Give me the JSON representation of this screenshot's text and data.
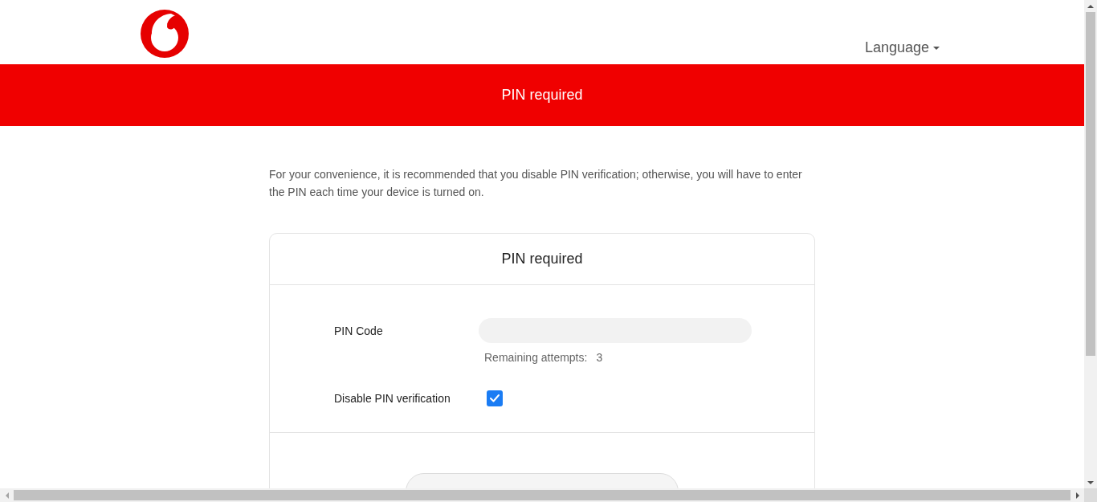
{
  "header": {
    "language_menu": {
      "label": "Language"
    }
  },
  "banner": {
    "title": "PIN required"
  },
  "intro": "For your convenience, it is recommended that you disable PIN verification; otherwise, you will have to enter the PIN each time your device is turned on.",
  "card": {
    "title": "PIN required",
    "pin_field": {
      "label": "PIN Code"
    },
    "remaining_attempts": {
      "label": "Remaining attempts:",
      "value": "3"
    },
    "disable_verification": {
      "label": "Disable PIN verification",
      "checked": true
    }
  }
}
